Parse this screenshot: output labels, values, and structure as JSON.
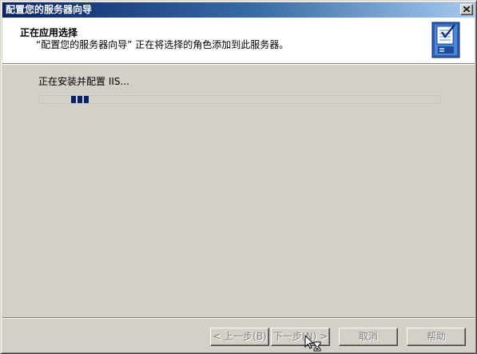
{
  "window": {
    "title": "配置您的服务器向导"
  },
  "header": {
    "title": "正在应用选择",
    "subtitle": "“配置您的服务器向导” 正在将选择的角色添加到此服务器。",
    "icon": "wizard-checklist-icon"
  },
  "main": {
    "status_text": "正在安装并配置 IIS...",
    "progress_indicator": "marquee",
    "progress_color": "#0a246a"
  },
  "buttons": {
    "back_label": "< 上一步(B)",
    "next_label": "下一步(N) >",
    "cancel_label": "取消",
    "help_label": "帮助"
  },
  "colors": {
    "titlebar_start": "#0a246a",
    "titlebar_end": "#a6caf0",
    "face": "#d4d0c8"
  }
}
